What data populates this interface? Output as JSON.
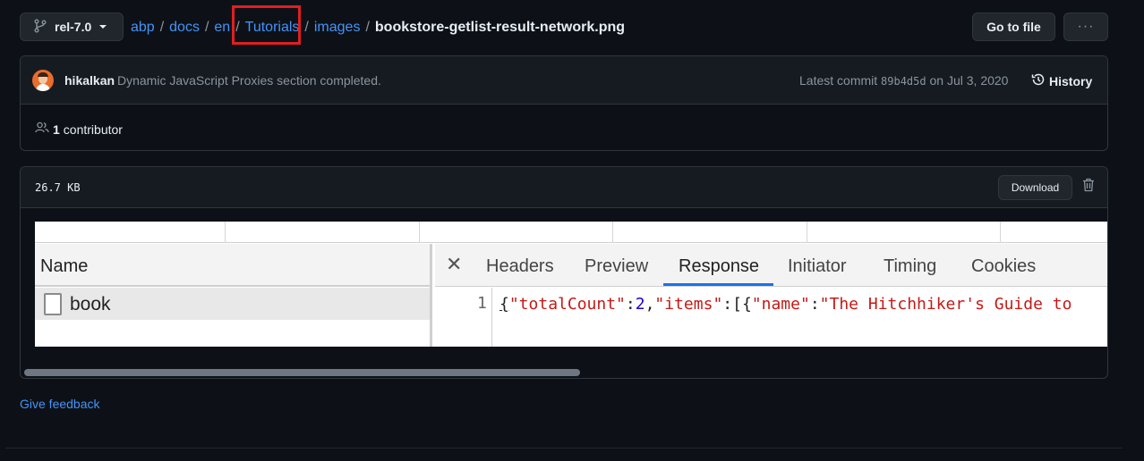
{
  "header": {
    "branch": "rel-7.0",
    "breadcrumb": [
      "abp",
      "docs",
      "en",
      "Tutorials",
      "images"
    ],
    "separator": "/",
    "filename": "bookstore-getlist-result-network.png",
    "goto_file": "Go to file",
    "more": "···"
  },
  "commit": {
    "author": "hikalkan",
    "message": "Dynamic JavaScript Proxies section completed.",
    "latest_label": "Latest commit",
    "sha": "89b4d5d",
    "date_text": "on Jul 3, 2020",
    "history": "History",
    "contributors_count": "1",
    "contributors_label": "contributor"
  },
  "file": {
    "size": "26.7 KB",
    "download": "Download"
  },
  "devtools": {
    "name_header": "Name",
    "request_name": "book",
    "close": "✕",
    "tabs": [
      "Headers",
      "Preview",
      "Response",
      "Initiator",
      "Timing",
      "Cookies"
    ],
    "active_tab": "Response",
    "line_number": "1",
    "code": {
      "open": "{",
      "k1": "\"totalCount\"",
      "c1": ":",
      "v1": "2",
      "c2": ",",
      "k2": "\"items\"",
      "c3": ":[{",
      "k3": "\"name\"",
      "c4": ":",
      "v3": "\"The Hitchhiker's Guide to"
    }
  },
  "footer": {
    "feedback": "Give feedback"
  },
  "colors": {
    "background": "#0d1117",
    "panel": "#161b22",
    "border": "#30363d",
    "link": "#4493f8",
    "highlight_box": "#e01f1f",
    "devtools_accent": "#1a73e8",
    "json_key": "#c41a16",
    "json_number": "#1c00cf"
  },
  "icons": [
    "git-branch-icon",
    "kebab-horizontal-icon",
    "history-icon",
    "people-icon",
    "trash-icon",
    "document-icon",
    "close-icon"
  ]
}
